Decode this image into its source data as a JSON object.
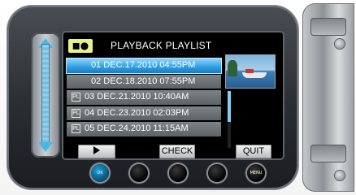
{
  "header": {
    "mode_icon": "movie-mode-icon",
    "title": "PLAYBACK PLAYLIST"
  },
  "playlist": {
    "items": [
      {
        "label": "01 DEC.17.2010 04:55PM",
        "selected": true,
        "icon": ""
      },
      {
        "label": "02 DEC.18.2010 07:55PM",
        "selected": false,
        "icon": ""
      },
      {
        "label": "03 DEC.21.2010 10:40AM",
        "selected": false,
        "icon": "playlist-icon"
      },
      {
        "label": "04 DEC.23.2010 02:03PM",
        "selected": false,
        "icon": "playlist-icon"
      },
      {
        "label": "05 DEC.24.2010 11:15AM",
        "selected": false,
        "icon": "playlist-icon"
      }
    ]
  },
  "buttons": {
    "play": "▶",
    "check": "CHECK",
    "quit": "QUIT"
  },
  "hardware": {
    "ok_label": "OK",
    "menu_label": "MENU"
  },
  "colors": {
    "selected_row": "#2b9de0",
    "row": "#6b7073",
    "accent": "#4ab6e6",
    "mode_badge": "#e6f28e"
  }
}
